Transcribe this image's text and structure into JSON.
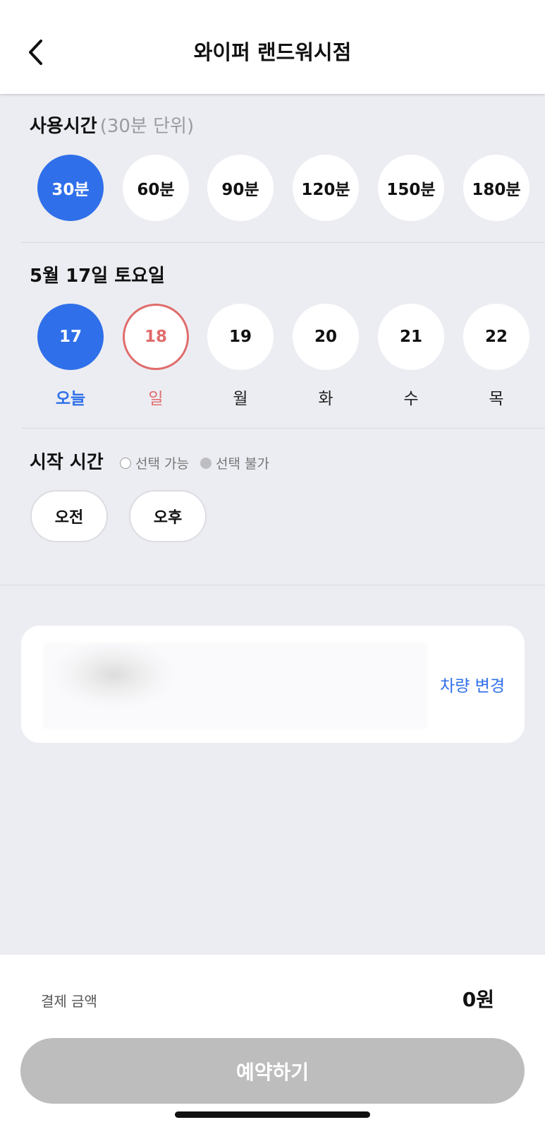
{
  "header": {
    "title": "와이퍼 랜드워시점",
    "back_icon": "chevron-left-icon"
  },
  "usage": {
    "title": "사용시간",
    "subtitle": "(30분 단위)",
    "options": [
      "30분",
      "60분",
      "90분",
      "120분",
      "150분",
      "180분"
    ],
    "selected": "30분"
  },
  "date": {
    "title": "5월 17일 토요일",
    "days": [
      {
        "num": "17",
        "label": "오늘"
      },
      {
        "num": "18",
        "label": "일"
      },
      {
        "num": "19",
        "label": "월"
      },
      {
        "num": "20",
        "label": "화"
      },
      {
        "num": "21",
        "label": "수"
      },
      {
        "num": "22",
        "label": "목"
      }
    ]
  },
  "start_time": {
    "title": "시작 시간",
    "legend_available": "선택 가능",
    "legend_unavailable": "선택 불가",
    "am": "오전",
    "pm": "오후"
  },
  "vehicle": {
    "change_label": "차량 변경"
  },
  "payment": {
    "label": "결제 금액",
    "amount": "0원"
  },
  "reserve_button": "예약하기",
  "colors": {
    "accent": "#2f6fe9",
    "sunday": "#e06c6c",
    "disabled_button": "#bdbdbd",
    "background": "#ecedf2"
  }
}
